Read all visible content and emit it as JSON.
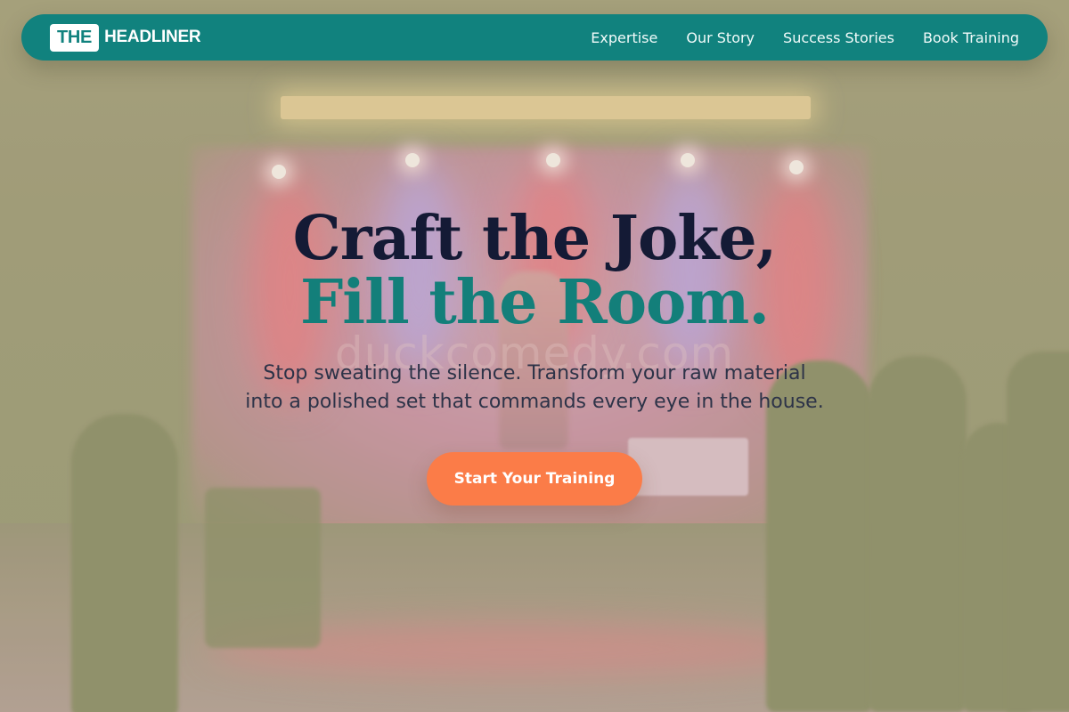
{
  "colors": {
    "nav_bg": "#11827e",
    "headline_dark": "#141a35",
    "headline_accent": "#137f7a",
    "cta_bg": "#fb7c48",
    "body_text": "#2d3348"
  },
  "nav": {
    "logo_badge": "THE",
    "logo_word": "HEADLINER",
    "links": [
      "Expertise",
      "Our Story",
      "Success Stories",
      "Book Training"
    ]
  },
  "hero": {
    "headline_line1": "Craft the Joke,",
    "headline_line2": "Fill the Room.",
    "subtitle_line1": "Stop sweating the silence. Transform your raw material",
    "subtitle_line2": "into a polished set that commands every eye in the house.",
    "cta_label": "Start Your Training"
  },
  "background": {
    "description_icon": "stage-photo",
    "watermark": "duckcomedy.com"
  }
}
